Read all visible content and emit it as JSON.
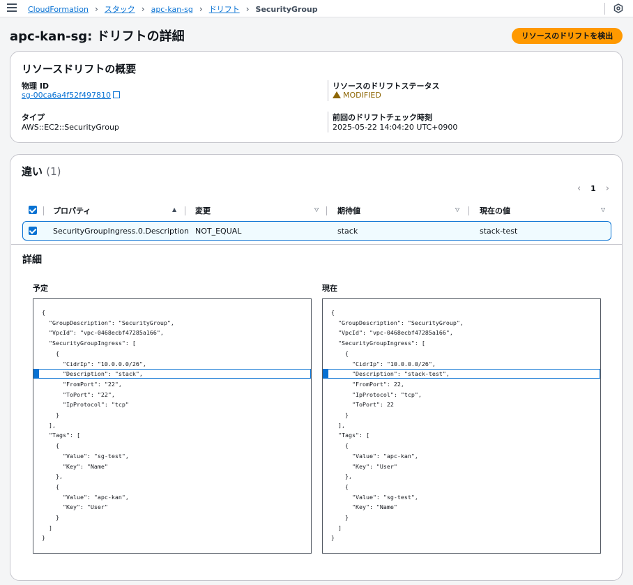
{
  "breadcrumb": {
    "items": [
      "CloudFormation",
      "スタック",
      "apc-kan-sg",
      "ドリフト"
    ],
    "current": "SecurityGroup"
  },
  "page": {
    "title": "apc-kan-sg: ドリフトの詳細",
    "detect_button": "リソースのドリフトを検出"
  },
  "summary": {
    "heading": "リソースドリフトの概要",
    "physical_id_label": "物理 ID",
    "physical_id": "sg-00ca6a4f52f497810",
    "type_label": "タイプ",
    "type": "AWS::EC2::SecurityGroup",
    "status_label": "リソースのドリフトステータス",
    "status": "MODIFIED",
    "last_check_label": "前回のドリフトチェック時刻",
    "last_check": "2025-05-22 14:04:20 UTC+0900",
    "status_color": "#8d6605"
  },
  "diff": {
    "heading": "違い",
    "count": "(1)",
    "page": "1",
    "columns": [
      "プロパティ",
      "変更",
      "期待値",
      "現在の値"
    ],
    "rows": [
      {
        "property": "SecurityGroupIngress.0.Description",
        "change": "NOT_EQUAL",
        "expected": "stack",
        "current": "stack-test"
      }
    ]
  },
  "details": {
    "heading": "詳細",
    "expected_label": "予定",
    "current_label": "現在",
    "expected_lines": [
      "{",
      "  \"GroupDescription\": \"SecurityGroup\",",
      "  \"VpcId\": \"vpc-0468ecbf47285a166\",",
      "  \"SecurityGroupIngress\": [",
      "    {",
      "      \"CidrIp\": \"10.0.0.0/26\",",
      "      \"Description\": \"stack\",",
      "      \"FromPort\": \"22\",",
      "      \"ToPort\": \"22\",",
      "      \"IpProtocol\": \"tcp\"",
      "    }",
      "  ],",
      "  \"Tags\": [",
      "    {",
      "      \"Value\": \"sg-test\",",
      "      \"Key\": \"Name\"",
      "    },",
      "    {",
      "      \"Value\": \"apc-kan\",",
      "      \"Key\": \"User\"",
      "    }",
      "  ]",
      "}"
    ],
    "current_lines": [
      "{",
      "  \"GroupDescription\": \"SecurityGroup\",",
      "  \"VpcId\": \"vpc-0468ecbf47285a166\",",
      "  \"SecurityGroupIngress\": [",
      "    {",
      "      \"CidrIp\": \"10.0.0.0/26\",",
      "      \"Description\": \"stack-test\",",
      "      \"FromPort\": 22,",
      "      \"IpProtocol\": \"tcp\",",
      "      \"ToPort\": 22",
      "    }",
      "  ],",
      "  \"Tags\": [",
      "    {",
      "      \"Value\": \"apc-kan\",",
      "      \"Key\": \"User\"",
      "    },",
      "    {",
      "      \"Value\": \"sg-test\",",
      "      \"Key\": \"Name\"",
      "    }",
      "  ]",
      "}"
    ],
    "highlight_line": 6
  }
}
